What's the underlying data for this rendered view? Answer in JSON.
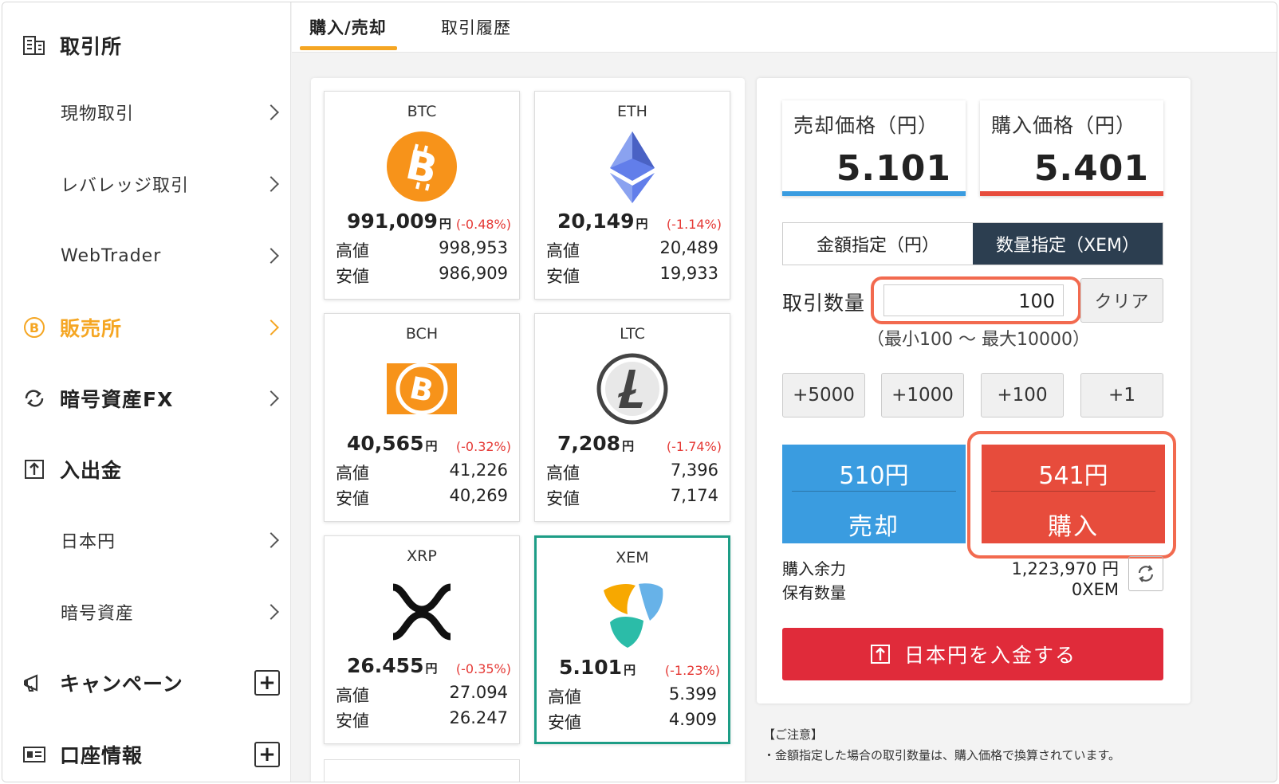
{
  "sidebar": {
    "exchange_title": "取引所",
    "spot": "現物取引",
    "leverage": "レバレッジ取引",
    "webtrader": "WebTrader",
    "store_title": "販売所",
    "fx_title": "暗号資産FX",
    "deposit_title": "入出金",
    "jpy": "日本円",
    "crypto": "暗号資産",
    "campaign_title": "キャンペーン",
    "account_title": "口座情報",
    "plus": "+"
  },
  "tabs": [
    {
      "label": "購入/売却"
    },
    {
      "label": "取引履歴"
    }
  ],
  "coins": [
    {
      "symbol": "BTC",
      "price": "991,009",
      "unit": "円",
      "change": "(-0.48%)",
      "high_label": "高値",
      "high": "998,953",
      "low_label": "安値",
      "low": "986,909",
      "icon": "bitcoin-icon"
    },
    {
      "symbol": "ETH",
      "price": "20,149",
      "unit": "円",
      "change": "(-1.14%)",
      "high_label": "高値",
      "high": "20,489",
      "low_label": "安値",
      "low": "19,933",
      "icon": "ethereum-icon"
    },
    {
      "symbol": "BCH",
      "price": "40,565",
      "unit": "円",
      "change": "(-0.32%)",
      "high_label": "高値",
      "high": "41,226",
      "low_label": "安値",
      "low": "40,269",
      "icon": "bitcoin-cash-icon"
    },
    {
      "symbol": "LTC",
      "price": "7,208",
      "unit": "円",
      "change": "(-1.74%)",
      "high_label": "高値",
      "high": "7,396",
      "low_label": "安値",
      "low": "7,174",
      "icon": "litecoin-icon"
    },
    {
      "symbol": "XRP",
      "price": "26.455",
      "unit": "円",
      "change": "(-0.35%)",
      "high_label": "高値",
      "high": "27.094",
      "low_label": "安値",
      "low": "26.247",
      "icon": "ripple-icon"
    },
    {
      "symbol": "XEM",
      "price": "5.101",
      "unit": "円",
      "change": "(-1.23%)",
      "high_label": "高値",
      "high": "5.399",
      "low_label": "安値",
      "low": "4.909",
      "icon": "nem-icon"
    }
  ],
  "trade": {
    "sell_price_label": "売却価格（円）",
    "sell_price": "5.101",
    "buy_price_label": "購入価格（円）",
    "buy_price": "5.401",
    "mode_amount": "金額指定（円）",
    "mode_quantity": "数量指定（XEM）",
    "qty_label": "取引数量",
    "qty_value": "100",
    "clear": "クリア",
    "range": "（最小100 ～ 最大10000）",
    "increments": [
      "+5000",
      "+1000",
      "+100",
      "+1"
    ],
    "sell_amount": "510円",
    "sell_label": "売却",
    "buy_amount": "541円",
    "buy_label": "購入",
    "available_label": "購入余力",
    "available_value": "1,223,970 円",
    "holding_label": "保有数量",
    "holding_value": "0XEM",
    "deposit_btn": "日本円を入金する"
  },
  "notice": {
    "title": "【ご注意】",
    "line1": "・金額指定した場合の取引数量は、購入価格で換算されています。"
  },
  "colors": {
    "accent_orange": "#f5a623",
    "sell_blue": "#3a9ce0",
    "buy_red": "#e74c3c",
    "deposit_red": "#e02b3a",
    "selected_green": "#1d9d86",
    "dark_toggle": "#2c3e50"
  }
}
